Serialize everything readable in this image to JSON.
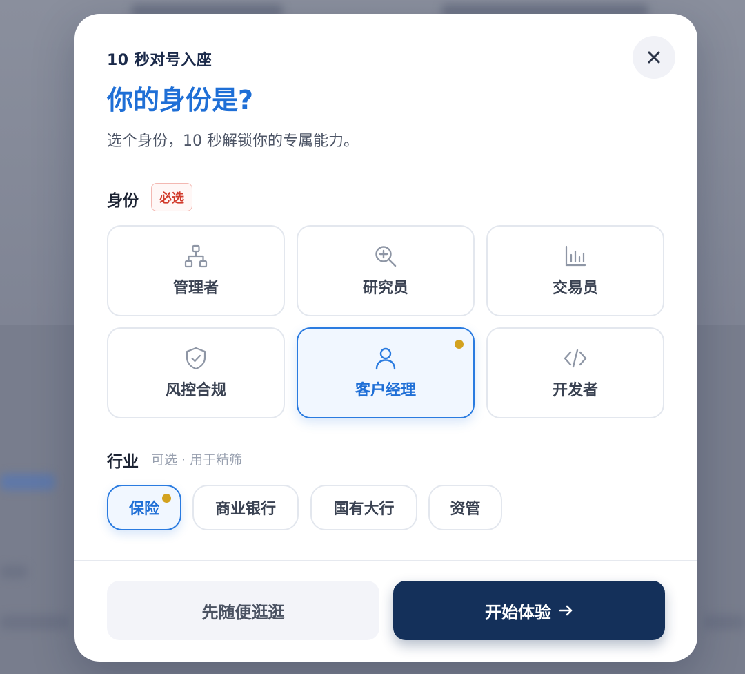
{
  "modal": {
    "eyebrow": "10 秒对号入座",
    "title": "你的身份是?",
    "subtitle": "选个身份，10 秒解锁你的专属能力。",
    "close_icon": "close-icon"
  },
  "identity": {
    "label": "身份",
    "required_badge": "必选",
    "roles": [
      {
        "label": "管理者",
        "icon": "org-chart-icon",
        "selected": false
      },
      {
        "label": "研究员",
        "icon": "zoom-in-icon",
        "selected": false
      },
      {
        "label": "交易员",
        "icon": "bar-chart-icon",
        "selected": false
      },
      {
        "label": "风控合规",
        "icon": "shield-check-icon",
        "selected": false
      },
      {
        "label": "客户经理",
        "icon": "user-icon",
        "selected": true
      },
      {
        "label": "开发者",
        "icon": "code-icon",
        "selected": false
      }
    ]
  },
  "industry": {
    "label": "行业",
    "note": "可选 · 用于精筛",
    "options": [
      {
        "label": "保险",
        "selected": true
      },
      {
        "label": "商业银行",
        "selected": false
      },
      {
        "label": "国有大行",
        "selected": false
      },
      {
        "label": "资管",
        "selected": false
      }
    ]
  },
  "footer": {
    "secondary_label": "先随便逛逛",
    "primary_label": "开始体验",
    "primary_icon": "arrow-right-icon"
  },
  "colors": {
    "accent": "#1f6fd6",
    "primary_button": "#14305a",
    "selection_dot": "#d3a21f",
    "required": "#d13b2c"
  }
}
